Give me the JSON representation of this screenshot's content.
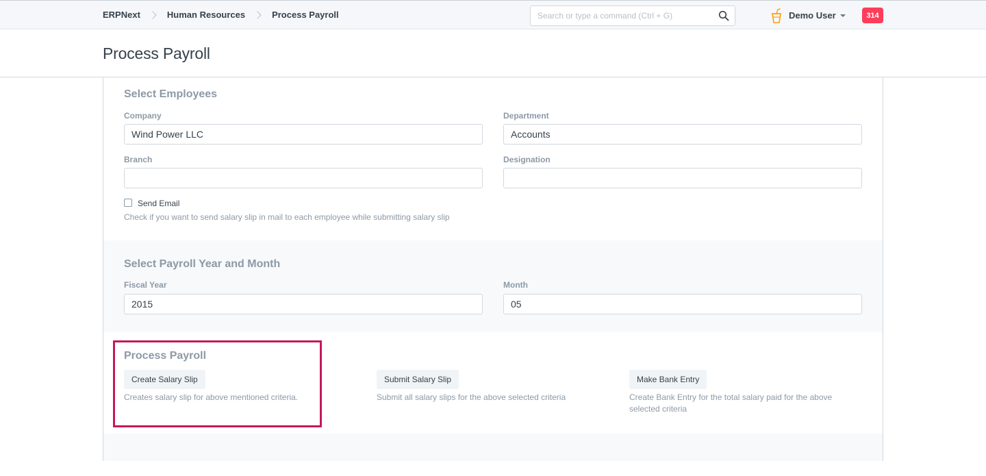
{
  "navbar": {
    "breadcrumbs": [
      "ERPNext",
      "Human Resources",
      "Process Payroll"
    ],
    "search_placeholder": "Search or type a command (Ctrl + G)",
    "user_name": "Demo User",
    "notification_count": "314",
    "icons": {
      "search": "search-icon",
      "cup": "cup-icon",
      "caret": "caret-down-icon"
    },
    "badge_color": "#ff3d5a"
  },
  "page": {
    "title": "Process Payroll"
  },
  "select_employees": {
    "heading": "Select Employees",
    "company": {
      "label": "Company",
      "value": "Wind Power LLC"
    },
    "department": {
      "label": "Department",
      "value": "Accounts"
    },
    "branch": {
      "label": "Branch",
      "value": ""
    },
    "designation": {
      "label": "Designation",
      "value": ""
    },
    "send_email": {
      "label": "Send Email",
      "checked": false,
      "help": "Check if you want to send salary slip in mail to each employee while submitting salary slip"
    }
  },
  "payroll_period": {
    "heading": "Select Payroll Year and Month",
    "fiscal_year": {
      "label": "Fiscal Year",
      "value": "2015"
    },
    "month": {
      "label": "Month",
      "value": "05"
    }
  },
  "process_payroll": {
    "heading": "Process Payroll",
    "actions": [
      {
        "label": "Create Salary Slip",
        "help": "Creates salary slip for above mentioned criteria."
      },
      {
        "label": "Submit Salary Slip",
        "help": "Submit all salary slips for the above selected criteria"
      },
      {
        "label": "Make Bank Entry",
        "help": "Create Bank Entry for the total salary paid for the above selected criteria"
      }
    ],
    "highlight_color": "#c5185c"
  }
}
